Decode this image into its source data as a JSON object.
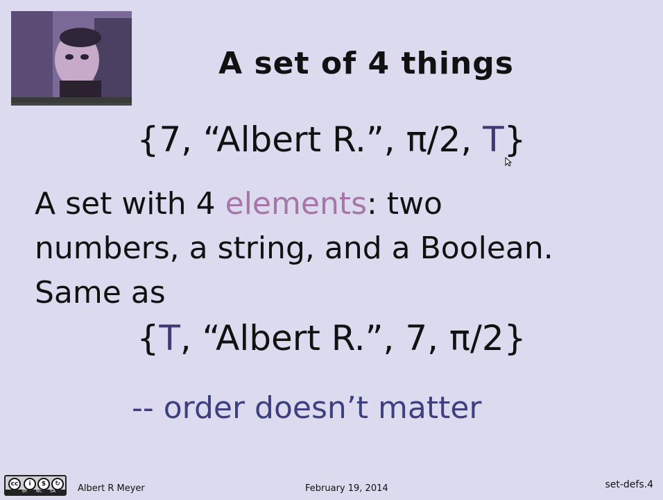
{
  "slide": {
    "title": "A set of 4 things",
    "set_one": {
      "open": "{7, “Albert R.”, π/2, ",
      "tee": "T",
      "close": "}"
    },
    "description": {
      "line1_pre": "A set with 4 ",
      "line1_highlight": "elements",
      "line1_post": ": two",
      "line2": "numbers, a string, and a Boolean.",
      "line3": "Same as"
    },
    "set_two": {
      "open": "{",
      "tee": "T",
      "rest": ", “Albert R.”, 7, π/2}"
    },
    "note": "-- order doesn’t matter"
  },
  "footer": {
    "license_icon": "cc-by-nc-sa-icon",
    "license_labels": [
      "BY",
      "NC",
      "SA"
    ],
    "author": "Albert R Meyer",
    "date": "February 19, 2014",
    "slide_id": "set-defs.4"
  },
  "video_overlay": {
    "icon": "webcam-video-icon"
  },
  "colors": {
    "background": "#dcdaee",
    "highlight": "#a576a6",
    "note": "#3e3f80"
  }
}
